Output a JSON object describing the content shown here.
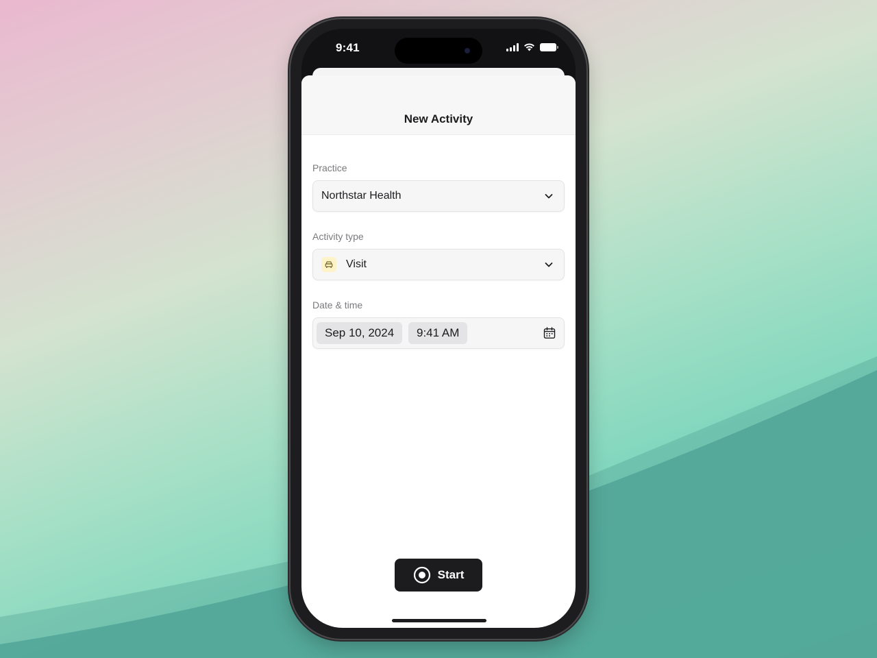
{
  "status_bar": {
    "time": "9:41"
  },
  "sheet": {
    "title": "New Activity"
  },
  "form": {
    "practice": {
      "label": "Practice",
      "value": "Northstar Health"
    },
    "activity_type": {
      "label": "Activity type",
      "value": "Visit",
      "icon": "car-icon"
    },
    "datetime": {
      "label": "Date & time",
      "date": "Sep 10, 2024",
      "time": "9:41 AM",
      "icon": "calendar-icon"
    }
  },
  "actions": {
    "start_label": "Start",
    "start_icon": "record-icon"
  },
  "colors": {
    "button_bg": "#1c1c1e",
    "type_icon_bg": "#fdf3c9",
    "field_bg": "#f6f6f7"
  }
}
